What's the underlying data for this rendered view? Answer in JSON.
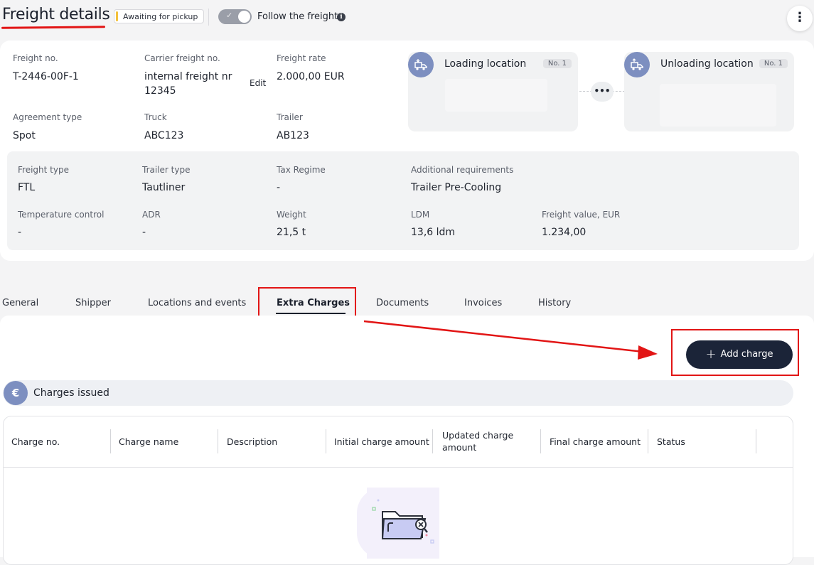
{
  "header": {
    "title": "Freight details",
    "status_badge": "Awaiting for pickup",
    "follow_label": "Follow the freight",
    "info_icon": "i",
    "kebab_icon": "⋮"
  },
  "details": {
    "freight_no_label": "Freight no.",
    "freight_no": "T-2446-00F-1",
    "carrier_label": "Carrier freight no.",
    "carrier_line1": "internal freight nr",
    "carrier_line2": "12345",
    "edit_label": "Edit",
    "rate_label": "Freight rate",
    "rate": "2.000,00 EUR",
    "agreement_label": "Agreement type",
    "agreement": "Spot",
    "truck_label": "Truck",
    "truck": "ABC123",
    "trailer_label": "Trailer",
    "trailer": "AB123"
  },
  "locations": {
    "loading": {
      "name": "Loading location",
      "no": "No. 1"
    },
    "unloading": {
      "name": "Unloading location",
      "no": "No. 1"
    },
    "more": "•••"
  },
  "specs": {
    "freight_type_label": "Freight type",
    "freight_type": "FTL",
    "trailer_type_label": "Trailer type",
    "trailer_type": "Tautliner",
    "tax_label": "Tax Regime",
    "tax": "-",
    "additional_label": "Additional requirements",
    "additional": "Trailer Pre-Cooling",
    "temp_label": "Temperature control",
    "temp": "-",
    "adr_label": "ADR",
    "adr": "-",
    "weight_label": "Weight",
    "weight": "21,5 t",
    "ldm_label": "LDM",
    "ldm": "13,6 ldm",
    "value_label": "Freight value, EUR",
    "value": "1.234,00"
  },
  "tabs": [
    {
      "label": "General"
    },
    {
      "label": "Shipper"
    },
    {
      "label": "Locations and events"
    },
    {
      "label": "Extra Charges",
      "active": true
    },
    {
      "label": "Documents"
    },
    {
      "label": "Invoices"
    },
    {
      "label": "History"
    }
  ],
  "charges": {
    "add_button": "Add charge",
    "section_title": "Charges issued",
    "columns": [
      "Charge no.",
      "Charge name",
      "Description",
      "Initial charge amount",
      "Updated charge amount",
      "Final charge amount",
      "Status"
    ]
  },
  "colors": {
    "accent": "#7d8fc0",
    "primary_button": "#1b2438",
    "annotation_red": "#e21515",
    "badge_yellow": "#f3c13b"
  }
}
